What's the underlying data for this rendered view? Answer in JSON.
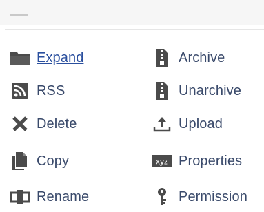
{
  "menu": {
    "left_column": [
      {
        "label": "Expand",
        "icon": "folder-icon"
      },
      {
        "label": "RSS",
        "icon": "rss-icon"
      },
      {
        "label": "Delete",
        "icon": "delete-x-icon"
      },
      {
        "label": "Copy",
        "icon": "copy-icon"
      },
      {
        "label": "Rename",
        "icon": "rename-icon"
      }
    ],
    "right_column": [
      {
        "label": "Archive",
        "icon": "archive-zip-icon"
      },
      {
        "label": "Unarchive",
        "icon": "unarchive-zip-icon"
      },
      {
        "label": "Upload",
        "icon": "upload-icon"
      },
      {
        "label": "Properties",
        "icon": "properties-xyz-icon"
      },
      {
        "label": "Permission",
        "icon": "key-icon"
      }
    ]
  },
  "colors": {
    "text": "#3a4a6b",
    "link": "#2a4f9e",
    "icon": "#4a4a4a",
    "top_bar": "#f6f6f6"
  }
}
